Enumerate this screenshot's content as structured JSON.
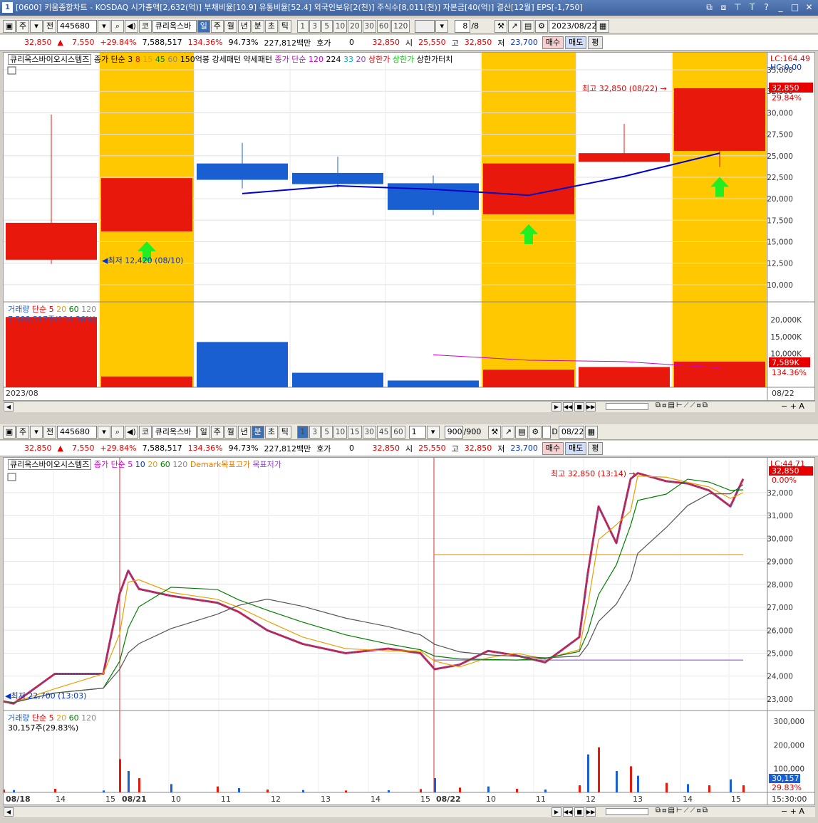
{
  "window": {
    "icon": "1",
    "title": "[0600] 키움종합차트 - KOSDAQ 시가총액[2,632(억)] 부채비율[10.9] 유통비율[52.4] 외국인보유[2(천)] 주식수[8,011(천)] 자본금[40(억)] 결산[12월] EPS[-1,750]",
    "controls": [
      "⧉",
      "⧈",
      "⊤",
      "T",
      "?",
      "_",
      "□",
      "✕"
    ]
  },
  "top": {
    "toolbar": {
      "period_sel": "주",
      "prev_label": "전",
      "code": "445680",
      "market": "코",
      "name": "큐리옥스바",
      "periods": [
        "일",
        "주",
        "월",
        "년",
        "분",
        "초",
        "틱"
      ],
      "active_period": "일",
      "nums": [
        "1",
        "3",
        "5",
        "10",
        "20",
        "30",
        "60",
        "120"
      ],
      "count": "8",
      "count_total": "/8",
      "date": "2023/08/22"
    },
    "quote": {
      "price": "32,850",
      "arrow": "▲",
      "change": "7,550",
      "pct": "+29.84%",
      "volume": "7,588,517",
      "vol_ratio": "134.36%",
      "turnover": "94.73%",
      "amount": "227,812백만",
      "hoga_label": "호가",
      "hoga": "0",
      "hoga_price": "32,850",
      "open_label": "시",
      "open": "25,550",
      "high_label": "고",
      "high": "32,850",
      "low_label": "저",
      "low": "23,700",
      "buy": "매수",
      "sell": "매도",
      "avg": "평"
    },
    "legend": {
      "stock": "큐리옥스바이오시스템즈",
      "ma_label": "종가 단순 3",
      "ma_vals": [
        "8",
        "15",
        "45",
        "60"
      ],
      "p1": "150억봉",
      "p2": "강세패턴",
      "p3": "약세패턴",
      "ma2_label": "종가 단순 120",
      "ma2_vals": [
        "224",
        "33",
        "20"
      ],
      "up1": "상한가",
      "up2": "상한가",
      "up3": "상한가",
      "up3b": "터치"
    },
    "price_axis": [
      "35,000",
      "32,500",
      "30,000",
      "27,500",
      "25,000",
      "22,500",
      "20,000",
      "17,500",
      "15,000",
      "12,500",
      "10,000"
    ],
    "lc": "LC:164.49",
    "hc": "HC:0.00",
    "last_price_tag": "32,850",
    "last_pct_tag": "29.84%",
    "high_note": "최고 32,850 (08/22)",
    "low_note": "최저 12,420 (08/10)",
    "vol_legend": {
      "label": "거래량",
      "ma": "단순 5",
      "v": [
        "20",
        "60",
        "120"
      ],
      "value": "7,588,517주(134.36%)"
    },
    "vol_axis": [
      "20,000K",
      "15,000K",
      "10,000K"
    ],
    "vol_tag": "7,589K",
    "vol_pct_tag": "134.36%",
    "x_start": "2023/08",
    "x_end": "08/22",
    "chart_data": {
      "type": "candlestick",
      "period": "daily",
      "categories": [
        "d1",
        "d2",
        "d3",
        "d4",
        "d5",
        "d6",
        "d7",
        "d8"
      ],
      "open": [
        12900,
        16200,
        24100,
        23000,
        21800,
        18200,
        24300,
        25550
      ],
      "close": [
        17200,
        22400,
        22200,
        21700,
        18700,
        24100,
        25300,
        32850
      ],
      "high": [
        29800,
        16600,
        26500,
        24900,
        22700,
        18900,
        28700,
        32850
      ],
      "low": [
        12420,
        16200,
        21200,
        21300,
        18100,
        18200,
        24300,
        23700
      ],
      "limit_up_highlight": [
        false,
        true,
        false,
        false,
        false,
        true,
        false,
        true
      ],
      "ma3": [
        null,
        null,
        20600,
        21500,
        21100,
        20400,
        22600,
        25300
      ],
      "volume_k": [
        20800,
        3200,
        13400,
        4300,
        2000,
        5200,
        6000,
        7589
      ],
      "vol_ma": [
        null,
        null,
        null,
        null,
        9600,
        8000,
        7600,
        5800
      ],
      "ylim": [
        8000,
        35500
      ],
      "vol_ylim": [
        0,
        24000
      ]
    }
  },
  "bottom": {
    "toolbar": {
      "period_sel": "주",
      "prev_label": "전",
      "code": "445680",
      "market": "코",
      "name": "큐리옥스바",
      "periods": [
        "일",
        "주",
        "월",
        "년",
        "분",
        "초",
        "틱"
      ],
      "active_period": "분",
      "nums": [
        "1",
        "3",
        "5",
        "10",
        "15",
        "30",
        "45",
        "60"
      ],
      "active_num": "1",
      "unit": "1",
      "count": "900",
      "count_total": "/900",
      "d_label": "D",
      "date": "08/22"
    },
    "quote": {
      "price": "32,850",
      "arrow": "▲",
      "change": "7,550",
      "pct": "+29.84%",
      "volume": "7,588,517",
      "vol_ratio": "134.36%",
      "turnover": "94.73%",
      "amount": "227,812백만",
      "hoga_label": "호가",
      "hoga": "0",
      "hoga_price": "32,850",
      "open_label": "시",
      "open": "25,550",
      "high_label": "고",
      "high": "32,850",
      "low_label": "저",
      "low": "23,700",
      "buy": "매수",
      "sell": "매도",
      "avg": "평"
    },
    "legend": {
      "stock": "큐리옥스바이오시스템즈",
      "ma_label": "종가 단순 5",
      "ma_vals": [
        "10",
        "20",
        "60",
        "120"
      ],
      "dm1": "Demark목표고가",
      "dm2": "목표저가"
    },
    "price_axis": [
      "32,000",
      "31,000",
      "30,000",
      "29,000",
      "28,000",
      "27,000",
      "26,000",
      "25,000",
      "24,000",
      "23,000"
    ],
    "lc": "LC:44.71",
    "last_price_tag": "32,850",
    "last_pct_tag": "0.00%",
    "high_note": "최고 32,850 (13:14)",
    "low_note": "최저 22,700 (13:03)",
    "vol_legend": {
      "label": "거래량",
      "ma": "단순 5",
      "v": [
        "20",
        "60",
        "120"
      ],
      "value": "30,157주(29.83%)"
    },
    "vol_axis": [
      "300,000",
      "200,000",
      "100,000"
    ],
    "vol_tag": "30,157",
    "vol_pct_tag": "29.83%",
    "x_labels": [
      "08/18",
      "14",
      "15",
      "08/21",
      "10",
      "11",
      "12",
      "13",
      "14",
      "15",
      "08/22",
      "10",
      "11",
      "12",
      "13",
      "14",
      "15"
    ],
    "x_end": "15:30:00",
    "chart_data": {
      "type": "line",
      "period": "1-minute",
      "x": [
        "08/18 13:00",
        "08/18 13:30",
        "08/18 14:00",
        "08/18 15:00",
        "08/21 09:00",
        "08/21 09:20",
        "08/21 09:40",
        "08/21 10:00",
        "08/21 10:30",
        "08/21 11:00",
        "08/21 11:30",
        "08/21 12:00",
        "08/21 13:00",
        "08/21 14:00",
        "08/21 15:00",
        "08/22 09:00",
        "08/22 09:30",
        "08/22 10:00",
        "08/22 10:30",
        "08/22 11:00",
        "08/22 12:00",
        "08/22 12:15",
        "08/22 12:30",
        "08/22 12:50",
        "08/22 13:00",
        "08/22 13:15",
        "08/22 13:40",
        "08/22 14:00",
        "08/22 14:30",
        "08/22 15:00",
        "08/22 15:20"
      ],
      "price": [
        22900,
        22800,
        24100,
        24100,
        27600,
        28600,
        27800,
        27500,
        27200,
        26800,
        26000,
        25400,
        25000,
        25200,
        25000,
        24300,
        24500,
        25100,
        24900,
        24600,
        25700,
        28500,
        31400,
        29800,
        32600,
        32850,
        32500,
        32400,
        32100,
        31400,
        32600
      ],
      "ylim": [
        22500,
        32900
      ],
      "demark_high": 29300,
      "demark_low": 24700,
      "volume_k": [
        12,
        10,
        15,
        8,
        140,
        90,
        60,
        35,
        25,
        18,
        12,
        10,
        8,
        9,
        14,
        60,
        20,
        25,
        15,
        12,
        30,
        160,
        190,
        90,
        110,
        70,
        40,
        35,
        30,
        55,
        30
      ],
      "vol_ylim": [
        0,
        330
      ]
    }
  }
}
